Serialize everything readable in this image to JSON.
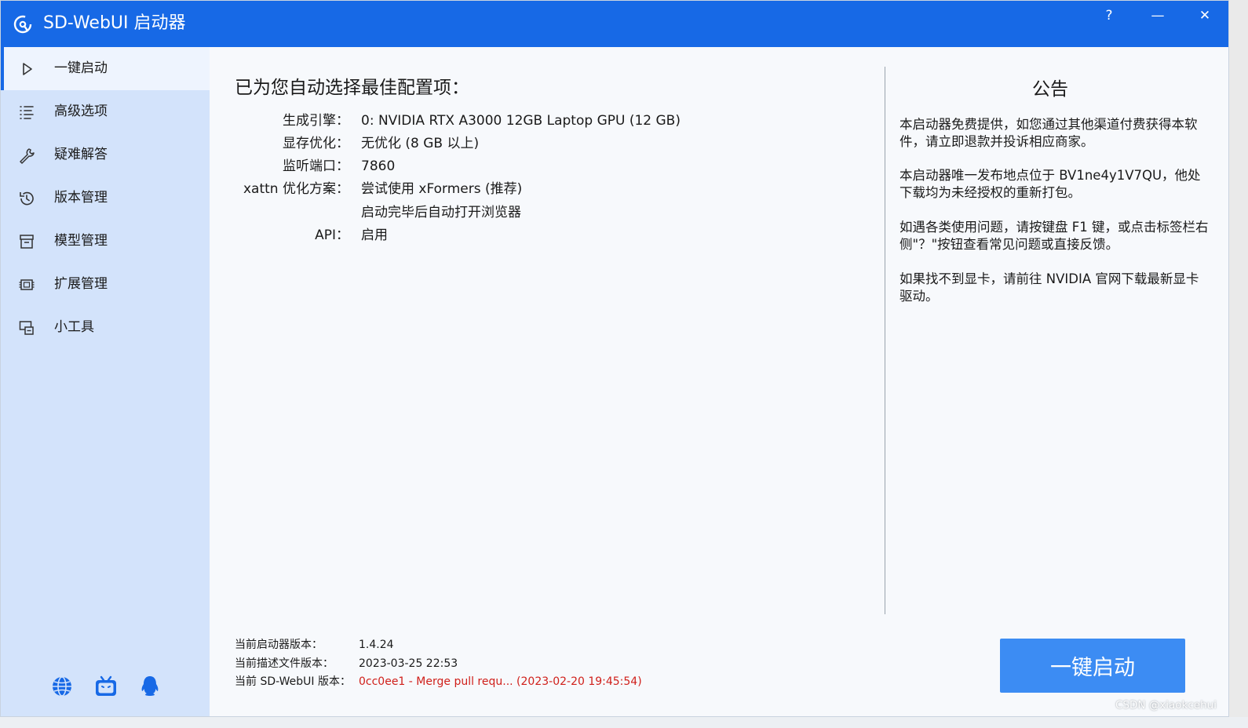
{
  "window": {
    "title": "SD-WebUI 启动器",
    "help_symbol": "?",
    "minimize_symbol": "—",
    "close_symbol": "✕",
    "accent": "#1769e6"
  },
  "sidebar": {
    "items": [
      {
        "label": "一键启动",
        "icon": "play-icon",
        "active": true
      },
      {
        "label": "高级选项",
        "icon": "list-icon"
      },
      {
        "label": "疑难解答",
        "icon": "wrench-icon"
      },
      {
        "label": "版本管理",
        "icon": "history-icon"
      },
      {
        "label": "模型管理",
        "icon": "archive-icon"
      },
      {
        "label": "扩展管理",
        "icon": "chip-icon"
      },
      {
        "label": "小工具",
        "icon": "tools-icon"
      }
    ],
    "bottom_icons": [
      "globe-icon",
      "bilibili-tv-icon",
      "qq-penguin-icon"
    ]
  },
  "main": {
    "heading": "已为您自动选择最佳配置项：",
    "config": [
      {
        "label": "生成引擎：",
        "value": "0: NVIDIA RTX A3000 12GB Laptop GPU (12 GB)"
      },
      {
        "label": "显存优化：",
        "value": "无优化 (8 GB 以上)"
      },
      {
        "label": "监听端口：",
        "value": "7860"
      },
      {
        "label": "xattn 优化方案：",
        "value": "尝试使用 xFormers (推荐)"
      },
      {
        "label": "",
        "value": "启动完毕后自动打开浏览器"
      },
      {
        "label": "API：",
        "value": "启用"
      }
    ],
    "versions": [
      {
        "label": "当前启动器版本：",
        "value": "1.4.24"
      },
      {
        "label": "当前描述文件版本：",
        "value": "2023-03-25 22:53"
      },
      {
        "label": "当前 SD-WebUI 版本：",
        "value": "0cc0ee1 - Merge pull requ... (2023-02-20 19:45:54)"
      }
    ]
  },
  "notice": {
    "title": "公告",
    "paragraphs": [
      "本启动器免费提供，如您通过其他渠道付费获得本软件，请立即退款并投诉相应商家。",
      "本启动器唯一发布地点位于 BV1ne4y1V7QU，他处下载均为未经授权的重新打包。",
      "如遇各类使用问题，请按键盘 F1 键，或点击标签栏右侧\"？\"按钮查看常见问题或直接反馈。",
      "如果找不到显卡，请前往 NVIDIA 官网下载最新显卡驱动。"
    ]
  },
  "launch_button": {
    "label": "一键启动",
    "color": "#3c8cf3"
  },
  "watermark": "CSDN @xiaokcehui"
}
